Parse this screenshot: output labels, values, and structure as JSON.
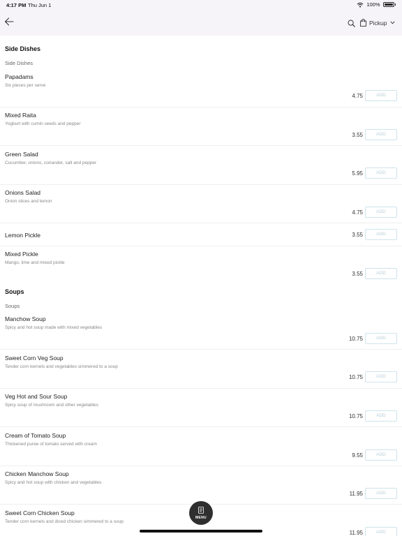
{
  "status_bar": {
    "time": "4:17 PM",
    "date": "Thu Jun 1",
    "battery": "100%"
  },
  "header": {
    "pickup_label": "Pickup"
  },
  "sections": [
    {
      "title": "Side Dishes",
      "subtitle": "Side Dishes",
      "items": [
        {
          "name": "Papadams",
          "description": "Six pieces per serve",
          "price": "4.75",
          "add_label": "ADD"
        },
        {
          "name": "Mixed Raita",
          "description": "Yogburt with cumin seeds and pepper",
          "price": "3.55",
          "add_label": "ADD"
        },
        {
          "name": "Green Salad",
          "description": "Cucumber, onions, coriander, salt and pepper",
          "price": "5.95",
          "add_label": "ADD"
        },
        {
          "name": "Onions Salad",
          "description": "Onion slices and lemon",
          "price": "4.75",
          "add_label": "ADD"
        },
        {
          "name": "Lemon Pickle",
          "description": "",
          "price": "3.55",
          "add_label": "ADD"
        },
        {
          "name": "Mixed Pickle",
          "description": "Mango, lime and mixed pickle",
          "price": "3.55",
          "add_label": "ADD"
        }
      ]
    },
    {
      "title": "Soups",
      "subtitle": "Soups",
      "items": [
        {
          "name": "Manchow Soup",
          "description": "Spicy and hot soup made with mixed vegetables",
          "price": "10.75",
          "add_label": "ADD"
        },
        {
          "name": "Sweet Corn Veg Soup",
          "description": "Tender corn kernels and vegetables simmered to a soup",
          "price": "10.75",
          "add_label": "ADD"
        },
        {
          "name": "Veg Hot and Sour Soup",
          "description": "Spicy soup of mushroom and other vegetables",
          "price": "10.75",
          "add_label": "ADD"
        },
        {
          "name": "Cream of Tomato Soup",
          "description": "Thickened puree of tomato served with cream",
          "price": "9.55",
          "add_label": "ADD"
        },
        {
          "name": "Chicken Manchow Soup",
          "description": "Spicy and hot soup with chicken and vegetables",
          "price": "11.95",
          "add_label": "ADD"
        },
        {
          "name": "Sweet Corn Chicken Soup",
          "description": "Tender corn kernels and diced chicken simmered to a soup",
          "price": "11.95",
          "add_label": "ADD"
        }
      ]
    }
  ],
  "menu_button": {
    "label": "MENU"
  },
  "icons": {
    "back": "arrow-left-icon",
    "search": "search-icon",
    "bag": "shopping-bag-icon",
    "dropdown": "chevron-down-icon",
    "menu": "document-icon",
    "wifi": "wifi-icon",
    "battery": "battery-icon"
  },
  "colors": {
    "header_bg": "#f6f4f8",
    "add_border": "#cfe3ec",
    "add_text": "#b8cfd9",
    "fab_bg": "#2f2f2f"
  }
}
